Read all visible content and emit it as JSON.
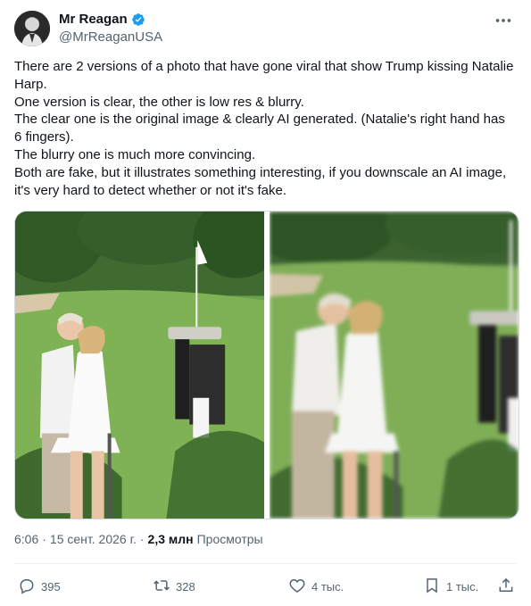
{
  "author": {
    "display_name": "Mr Reagan",
    "handle": "@MrReaganUSA",
    "verified": true
  },
  "icons": {
    "verified": "verified-badge-icon",
    "more": "more-dots-icon",
    "reply": "reply-icon",
    "retweet": "retweet-icon",
    "like": "heart-icon",
    "bookmark": "bookmark-icon",
    "share": "share-icon"
  },
  "colors": {
    "accent": "#1d9bf0",
    "text": "#0f1419",
    "secondary": "#536471"
  },
  "tweet": {
    "paragraphs": [
      "There are 2 versions of a photo that have gone viral that show Trump kissing Natalie Harp.",
      "One version is clear, the other is low res & blurry.",
      "The clear one is the original image & clearly AI generated. (Natalie's right hand has 6 fingers).",
      "The blurry one is much more convincing.",
      "Both are fake, but it illustrates something interesting, if you downscale an AI image, it's very hard to detect whether or not it's fake."
    ]
  },
  "meta": {
    "time": "6:06",
    "sep1": "·",
    "date": "15 сент. 2026 г.",
    "sep2": "·",
    "views_count": "2,3 млн",
    "views_label": "Просмотры"
  },
  "actions": {
    "replies": "395",
    "retweets": "328",
    "likes": "4 тыс.",
    "bookmarks": "1 тыс."
  }
}
